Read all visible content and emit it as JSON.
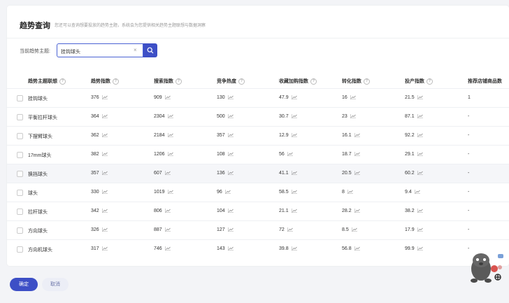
{
  "header": {
    "title": "趋势查询",
    "subtitle": "您还可以查询想要投放的趋势主题，系统会为您提供相关趋势主题联想与数据洞察"
  },
  "search": {
    "label": "当前趋势主题:",
    "value": "挂钩球头"
  },
  "table": {
    "columns": [
      "趋势主题联想",
      "趋势指数",
      "搜索指数",
      "竞争热度",
      "收藏加购指数",
      "转化指数",
      "投产指数",
      "推荐店铺商品数"
    ],
    "rows": [
      {
        "name": "挂钩球头",
        "trend": "376",
        "search": "909",
        "compete": "130",
        "fav": "47.9",
        "conv": "16",
        "roi": "21.5",
        "count": "1"
      },
      {
        "name": "平衡拉杆球头",
        "trend": "364",
        "search": "2304",
        "compete": "500",
        "fav": "30.7",
        "conv": "23",
        "roi": "87.1",
        "count": "-"
      },
      {
        "name": "下摆臂球头",
        "trend": "362",
        "search": "2184",
        "compete": "357",
        "fav": "12.9",
        "conv": "16.1",
        "roi": "92.2",
        "count": "-"
      },
      {
        "name": "17mm球头",
        "trend": "382",
        "search": "1206",
        "compete": "108",
        "fav": "56",
        "conv": "18.7",
        "roi": "29.1",
        "count": "-"
      },
      {
        "name": "换挡球头",
        "trend": "357",
        "search": "607",
        "compete": "136",
        "fav": "41.1",
        "conv": "20.5",
        "roi": "60.2",
        "count": "-"
      },
      {
        "name": "球头",
        "trend": "330",
        "search": "1019",
        "compete": "96",
        "fav": "58.5",
        "conv": "8",
        "roi": "9.4",
        "count": "-"
      },
      {
        "name": "拉杆球头",
        "trend": "342",
        "search": "806",
        "compete": "104",
        "fav": "21.1",
        "conv": "28.2",
        "roi": "38.2",
        "count": "-"
      },
      {
        "name": "方向球头",
        "trend": "326",
        "search": "887",
        "compete": "127",
        "fav": "72",
        "conv": "8.5",
        "roi": "17.9",
        "count": "-"
      },
      {
        "name": "方向机球头",
        "trend": "317",
        "search": "746",
        "compete": "143",
        "fav": "39.8",
        "conv": "56.8",
        "roi": "99.9",
        "count": "-"
      }
    ]
  },
  "footer": {
    "confirm_label": "确定",
    "cancel_label": "取消"
  },
  "colors": {
    "accent": "#3d4fc6",
    "highlight_row": "#f5f6f9"
  }
}
